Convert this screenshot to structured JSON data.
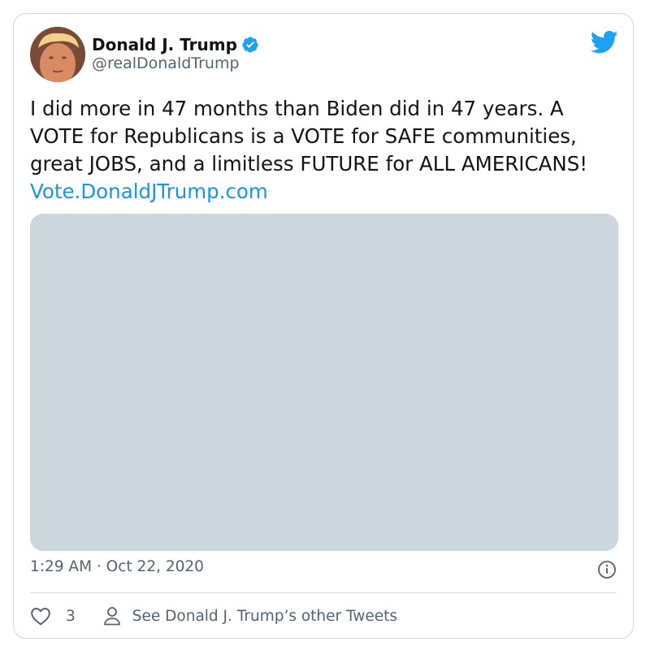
{
  "user": {
    "display_name": "Donald J. Trump",
    "handle": "@realDonaldTrump",
    "verified": true,
    "avatar_icon": "profile-photo"
  },
  "tweet": {
    "text": "I did more in 47 months than Biden did in 47 years. A VOTE for Republicans is a VOTE for SAFE communities, great JOBS, and a limitless FUTURE for ALL AMERICANS! ",
    "link_text": "Vote.DonaldJTrump.com",
    "timestamp": "1:29 AM · Oct 22, 2020"
  },
  "actions": {
    "like_count": "3",
    "profile_link_label": "See Donald J. Trump’s other Tweets"
  },
  "colors": {
    "accent": "#1da1f2",
    "link": "#1b95e0",
    "text": "#0f1419",
    "secondary_text": "#536471",
    "border": "#cfd9de",
    "media_placeholder": "#ccd6dd"
  },
  "icons": {
    "brand": "twitter-bird-icon",
    "verified": "verified-badge-icon",
    "info": "info-icon",
    "like": "heart-icon",
    "profile": "person-icon"
  }
}
